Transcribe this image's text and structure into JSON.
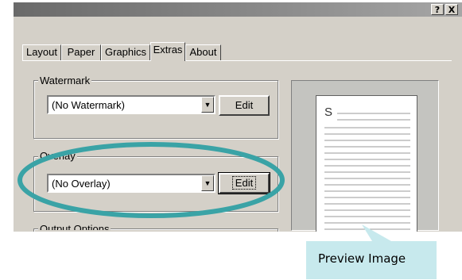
{
  "title_buttons": {
    "help": "?",
    "close": "X"
  },
  "tabs": [
    {
      "label": "Layout"
    },
    {
      "label": "Paper"
    },
    {
      "label": "Graphics"
    },
    {
      "label": "Extras",
      "active": true
    },
    {
      "label": "About"
    }
  ],
  "watermark": {
    "legend": "Watermark",
    "selected": "(No Watermark)",
    "edit_label": "Edit"
  },
  "overlay": {
    "legend": "Overlay",
    "selected": "(No Overlay)",
    "edit_label": "Edit"
  },
  "output_options": {
    "legend": "Output Options"
  },
  "preview": {
    "letter": "S"
  },
  "callout": {
    "text": "Preview Image",
    "color": "#c7e9ed"
  },
  "highlight": {
    "shape": "ellipse",
    "color": "#3aa3a6"
  }
}
